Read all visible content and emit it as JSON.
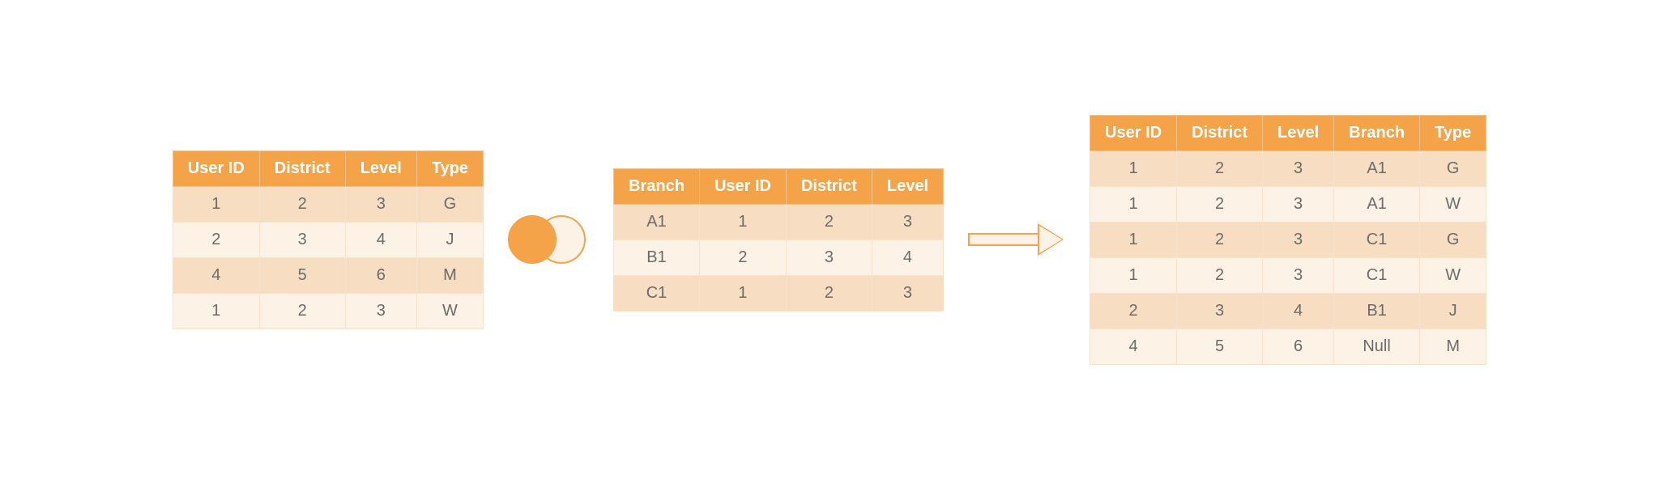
{
  "colors": {
    "header": "#f5a348",
    "rowOdd": "#f7ddc2",
    "rowEven": "#fdf2e6",
    "text": "#6b6b6b"
  },
  "leftTable": {
    "headers": [
      "User ID",
      "District",
      "Level",
      "Type"
    ],
    "rows": [
      [
        "1",
        "2",
        "3",
        "G"
      ],
      [
        "2",
        "3",
        "4",
        "J"
      ],
      [
        "4",
        "5",
        "6",
        "M"
      ],
      [
        "1",
        "2",
        "3",
        "W"
      ]
    ]
  },
  "middleTable": {
    "headers": [
      "Branch",
      "User ID",
      "District",
      "Level"
    ],
    "rows": [
      [
        "A1",
        "1",
        "2",
        "3"
      ],
      [
        "B1",
        "2",
        "3",
        "4"
      ],
      [
        "C1",
        "1",
        "2",
        "3"
      ]
    ]
  },
  "rightTable": {
    "headers": [
      "User ID",
      "District",
      "Level",
      "Branch",
      "Type"
    ],
    "rows": [
      [
        "1",
        "2",
        "3",
        "A1",
        "G"
      ],
      [
        "1",
        "2",
        "3",
        "A1",
        "W"
      ],
      [
        "1",
        "2",
        "3",
        "C1",
        "G"
      ],
      [
        "1",
        "2",
        "3",
        "C1",
        "W"
      ],
      [
        "2",
        "3",
        "4",
        "B1",
        "J"
      ],
      [
        "4",
        "5",
        "6",
        "Null",
        "M"
      ]
    ]
  },
  "joinType": "left-join",
  "chart_data": {
    "type": "table",
    "description": "Left join diagram: left table joined with branch table on User ID, District, Level producing result table",
    "left": {
      "columns": [
        "User ID",
        "District",
        "Level",
        "Type"
      ],
      "rows": [
        [
          "1",
          "2",
          "3",
          "G"
        ],
        [
          "2",
          "3",
          "4",
          "J"
        ],
        [
          "4",
          "5",
          "6",
          "M"
        ],
        [
          "1",
          "2",
          "3",
          "W"
        ]
      ]
    },
    "right": {
      "columns": [
        "Branch",
        "User ID",
        "District",
        "Level"
      ],
      "rows": [
        [
          "A1",
          "1",
          "2",
          "3"
        ],
        [
          "B1",
          "2",
          "3",
          "4"
        ],
        [
          "C1",
          "1",
          "2",
          "3"
        ]
      ]
    },
    "result": {
      "columns": [
        "User ID",
        "District",
        "Level",
        "Branch",
        "Type"
      ],
      "rows": [
        [
          "1",
          "2",
          "3",
          "A1",
          "G"
        ],
        [
          "1",
          "2",
          "3",
          "A1",
          "W"
        ],
        [
          "1",
          "2",
          "3",
          "C1",
          "G"
        ],
        [
          "1",
          "2",
          "3",
          "C1",
          "W"
        ],
        [
          "2",
          "3",
          "4",
          "B1",
          "J"
        ],
        [
          "4",
          "5",
          "6",
          "Null",
          "M"
        ]
      ]
    }
  }
}
